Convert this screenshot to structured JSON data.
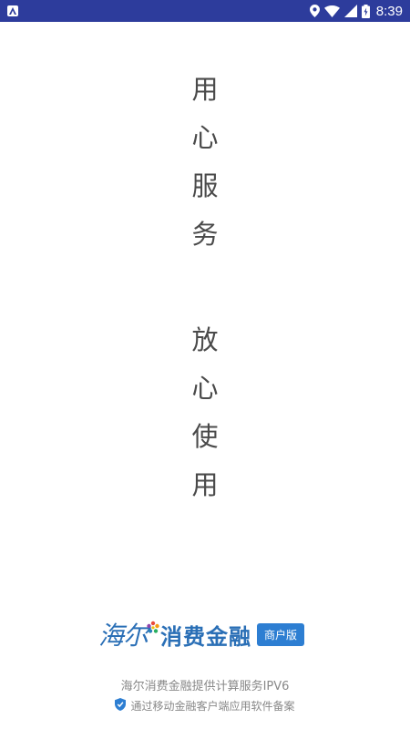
{
  "status_bar": {
    "time": "8:39",
    "icons": [
      "app-notification-icon",
      "location-icon",
      "wifi-icon",
      "cell-signal-icon",
      "battery-charging-icon"
    ],
    "background_color": "#2d3c9c"
  },
  "slogans": {
    "first": [
      "用",
      "心",
      "服",
      "务"
    ],
    "second": [
      "放",
      "心",
      "使",
      "用"
    ],
    "text_color": "#4a4a4a"
  },
  "branding": {
    "script_text": "海尔",
    "name": "消费金融",
    "badge": "商户版",
    "accent_color": "#2a6fb6",
    "badge_color": "#2d7ed2"
  },
  "footer": {
    "ipv6_text": "海尔消费金融提供计算服务IPV6",
    "filing_text": "通过移动金融客户端应用软件备案",
    "filing_icon": "shield-check-icon"
  }
}
